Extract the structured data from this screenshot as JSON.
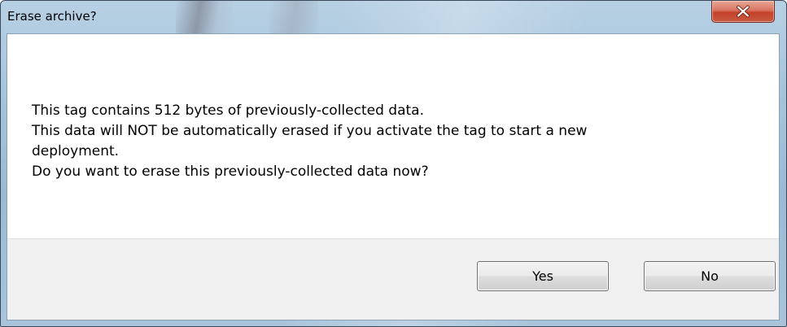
{
  "dialog": {
    "title": "Erase archive?",
    "close_label": "x",
    "message_lines": [
      "This tag contains 512 bytes of previously-collected data.",
      "This data will NOT be automatically erased if you activate the tag to start a new",
      "deployment.",
      "Do you want to erase this previously-collected data now?"
    ],
    "buttons": {
      "yes_label": "Yes",
      "no_label": "No"
    }
  },
  "colors": {
    "frame": "#a6c3db",
    "close_button": "#c4422a",
    "button_area": "#f0f0f0"
  },
  "icons": {
    "close": "close-icon"
  }
}
